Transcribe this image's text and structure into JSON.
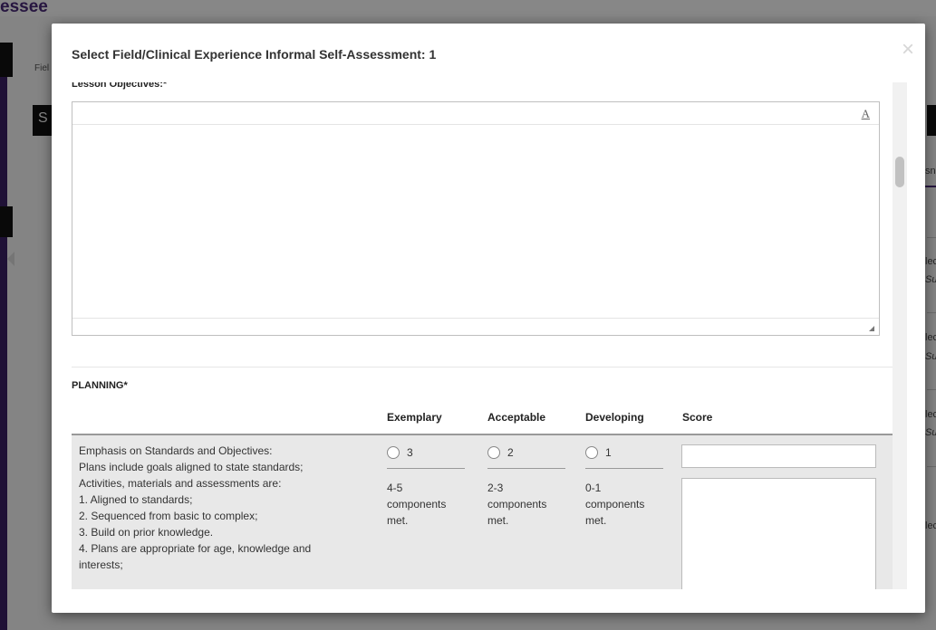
{
  "background": {
    "brand_partial": "essee",
    "breadcrumb_partial": "Fiel",
    "dark_box_letter": "S",
    "right_fragments": [
      "sn",
      "lec",
      "Su",
      "lec",
      "Su",
      "lec",
      "Su",
      "lec"
    ]
  },
  "modal": {
    "title": "Select Field/Clinical Experience Informal Self-Assessment: 1",
    "close_glyph": "×"
  },
  "lesson_objectives": {
    "label": "Lesson Objectives:*",
    "font_icon_glyph": "A",
    "value": ""
  },
  "planning": {
    "section_label": "PLANNING*",
    "columns": [
      "Exemplary",
      "Acceptable",
      "Developing",
      "Score"
    ],
    "rows": [
      {
        "criterion_lines": [
          "Emphasis on Standards and Objectives:",
          "Plans include goals aligned to state standards;",
          "Activities, materials and assessments are:",
          "1. Aligned to standards;",
          "2. Sequenced from basic to complex;",
          "3. Build on prior knowledge.",
          "4. Plans are appropriate for age, knowledge and",
          "interests;"
        ],
        "options": [
          {
            "value": "3",
            "desc_lines": [
              "4-5",
              "components",
              "met."
            ]
          },
          {
            "value": "2",
            "desc_lines": [
              "2-3",
              "components",
              "met."
            ]
          },
          {
            "value": "1",
            "desc_lines": [
              "0-1",
              "components",
              "met."
            ]
          }
        ],
        "score_value": "",
        "comment_value": ""
      }
    ]
  }
}
